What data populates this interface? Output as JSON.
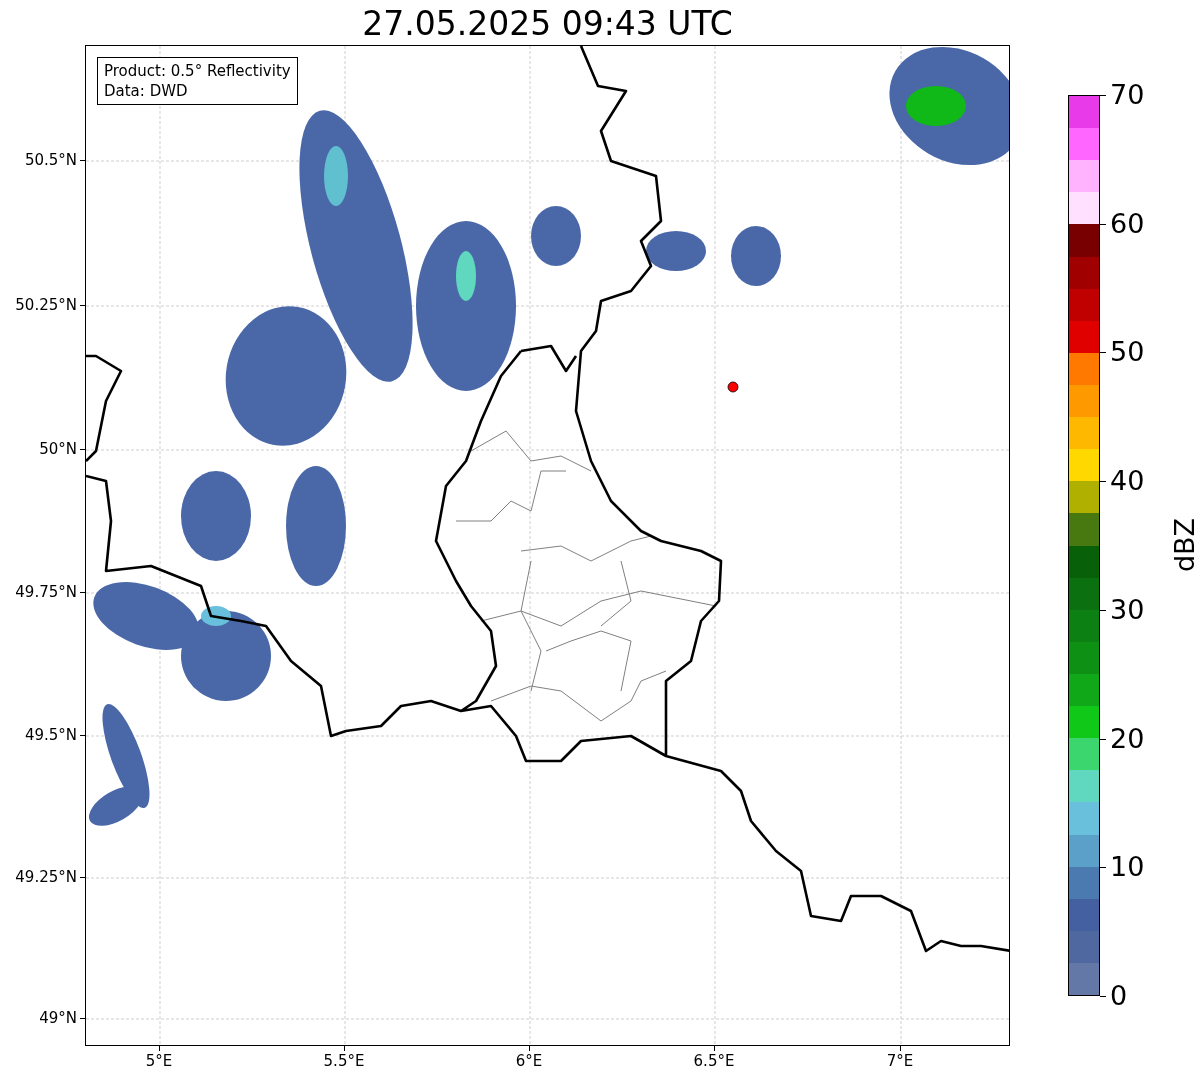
{
  "title": "27.05.2025 09:43 UTC",
  "info_box": {
    "lines": [
      "Product: 0.5° Reflectivity",
      "Data: DWD"
    ]
  },
  "map": {
    "y_ticks": [
      "50.5°N",
      "50.25°N",
      "50°N",
      "49.75°N",
      "49.5°N",
      "49.25°N",
      "49°N"
    ],
    "x_ticks": [
      "5°E",
      "5.5°E",
      "6°E",
      "6.5°E",
      "7°E"
    ]
  },
  "colorbar": {
    "label": "dBZ",
    "ticks": [
      "70",
      "60",
      "50",
      "40",
      "30",
      "20",
      "10",
      "0"
    ],
    "segments": [
      {
        "color": "#e93ae9"
      },
      {
        "color": "#ff66ff"
      },
      {
        "color": "#ffb3ff"
      },
      {
        "color": "#ffe0ff"
      },
      {
        "color": "#780000"
      },
      {
        "color": "#a00000"
      },
      {
        "color": "#c00000"
      },
      {
        "color": "#e00000"
      },
      {
        "color": "#ff7800"
      },
      {
        "color": "#ff9900"
      },
      {
        "color": "#ffb800"
      },
      {
        "color": "#ffd800"
      },
      {
        "color": "#b0b000"
      },
      {
        "color": "#487810"
      },
      {
        "color": "#086008"
      },
      {
        "color": "#0a7010"
      },
      {
        "color": "#0c8012"
      },
      {
        "color": "#0e9014"
      },
      {
        "color": "#10a818"
      },
      {
        "color": "#10c818"
      },
      {
        "color": "#3cd66e"
      },
      {
        "color": "#60d8c0"
      },
      {
        "color": "#68c0dc"
      },
      {
        "color": "#5aa0c8"
      },
      {
        "color": "#4a7ab0"
      },
      {
        "color": "#4460a0"
      },
      {
        "color": "#5068a0"
      },
      {
        "color": "#6478a8"
      }
    ]
  }
}
